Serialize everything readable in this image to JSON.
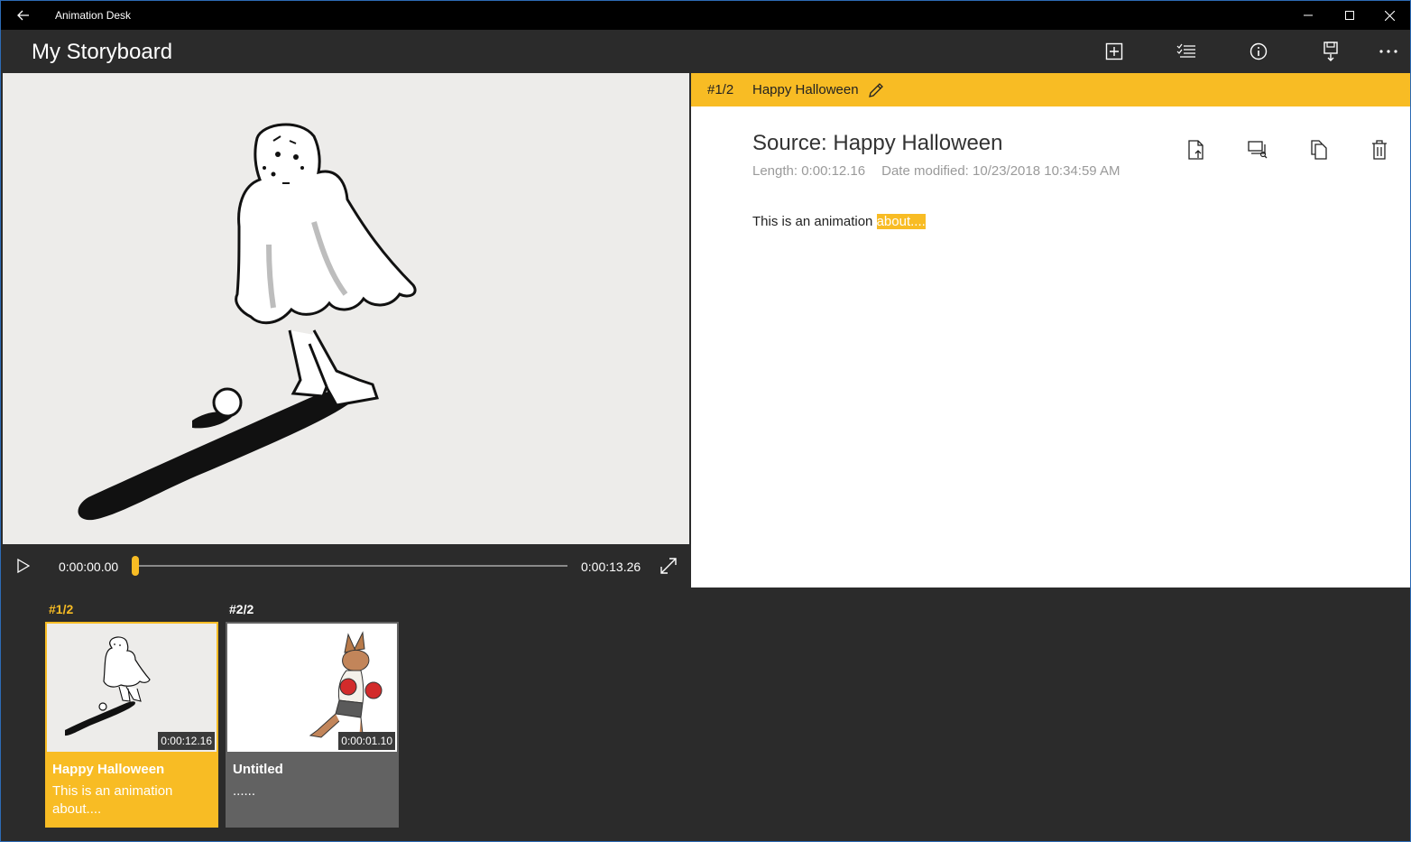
{
  "window": {
    "app_title": "Animation Desk"
  },
  "appbar": {
    "title": "My Storyboard",
    "commands": [
      "add-storyboard-icon",
      "select-list-icon",
      "info-icon",
      "save-export-icon",
      "more-icon"
    ]
  },
  "player": {
    "current_time": "0:00:00.00",
    "end_time": "0:00:13.26",
    "progress": 0
  },
  "details": {
    "number": "#1/2",
    "name": "Happy Halloween",
    "source_title": "Source: Happy Halloween",
    "length": "Length: 0:00:12.16",
    "date_modified": "Date modified: 10/23/2018 10:34:59 AM",
    "description_plain": "This is an animation ",
    "description_highlight": "about....",
    "actions": [
      "export-file-icon",
      "replace-source-icon",
      "duplicate-icon",
      "delete-icon"
    ]
  },
  "storyboard": {
    "cards": [
      {
        "number": "#1/2",
        "title": "Happy Halloween",
        "description": "This is an animation about....",
        "duration": "0:00:12.16",
        "selected": true
      },
      {
        "number": "#2/2",
        "title": "Untitled",
        "description": "......",
        "duration": "0:00:01.10",
        "selected": false
      }
    ]
  },
  "colors": {
    "accent": "#f8bc24",
    "appbar": "#2b2b2b",
    "titlebar": "#000000",
    "card_unselected": "#626262"
  }
}
